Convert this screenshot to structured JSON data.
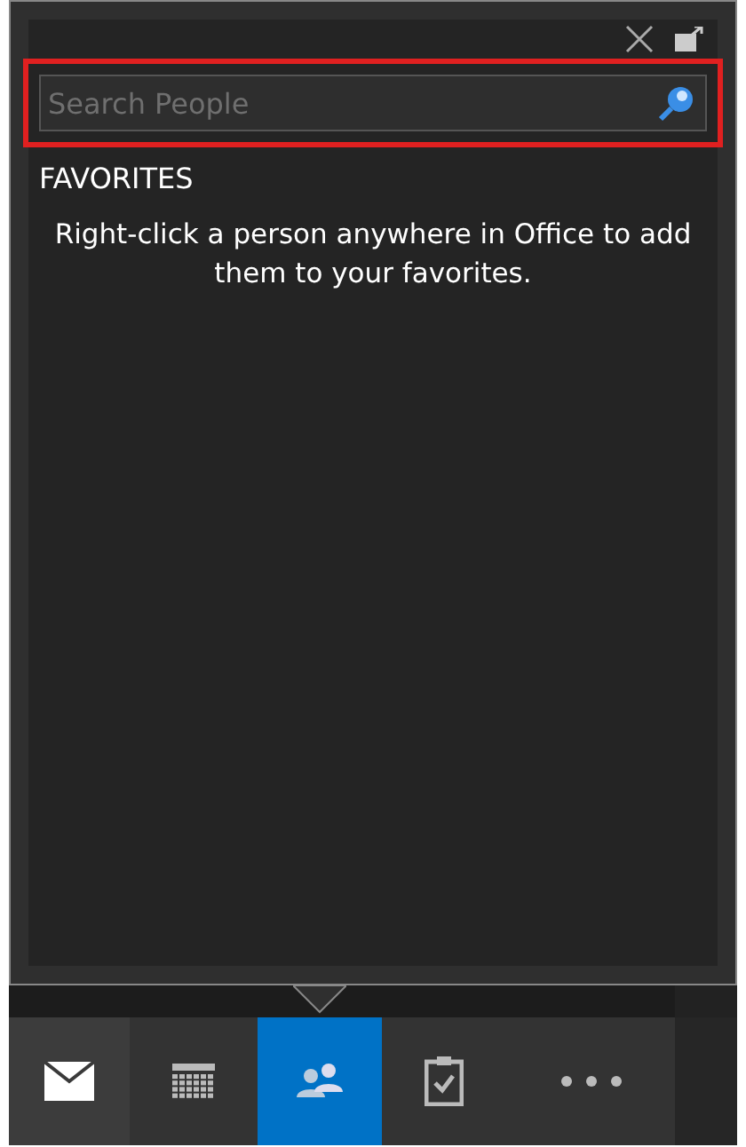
{
  "search": {
    "placeholder": "Search People"
  },
  "favorites": {
    "heading": "FAVORITES",
    "hint": "Right-click a person anywhere in Office to add them to your favorites."
  },
  "nav": [
    {
      "kind": "mail",
      "selected": false
    },
    {
      "kind": "calendar",
      "selected": false
    },
    {
      "kind": "people",
      "selected": true
    },
    {
      "kind": "tasks",
      "selected": false
    },
    {
      "kind": "more",
      "selected": false
    }
  ]
}
